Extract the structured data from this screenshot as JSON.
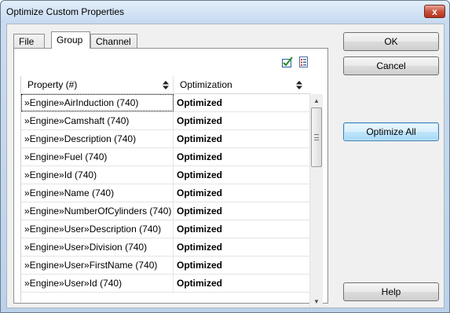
{
  "window": {
    "title": "Optimize Custom Properties",
    "close_glyph": "x"
  },
  "tabs": [
    {
      "label": "File",
      "active": false
    },
    {
      "label": "Group",
      "active": true
    },
    {
      "label": "Channel",
      "active": false
    }
  ],
  "toolbar": {
    "icons": [
      "check-all-icon",
      "properties-list-icon"
    ]
  },
  "grid": {
    "columns": [
      "Property (#)",
      "Optimization"
    ],
    "rows": [
      {
        "property": "»Engine»AirInduction (740)",
        "optimization": "Optimized"
      },
      {
        "property": "»Engine»Camshaft (740)",
        "optimization": "Optimized"
      },
      {
        "property": "»Engine»Description (740)",
        "optimization": "Optimized"
      },
      {
        "property": "»Engine»Fuel (740)",
        "optimization": "Optimized"
      },
      {
        "property": "»Engine»Id (740)",
        "optimization": "Optimized"
      },
      {
        "property": "»Engine»Name (740)",
        "optimization": "Optimized"
      },
      {
        "property": "»Engine»NumberOfCylinders (740)",
        "optimization": "Optimized"
      },
      {
        "property": "»Engine»User»Description (740)",
        "optimization": "Optimized"
      },
      {
        "property": "»Engine»User»Division (740)",
        "optimization": "Optimized"
      },
      {
        "property": "»Engine»User»FirstName (740)",
        "optimization": "Optimized"
      },
      {
        "property": "»Engine»User»Id (740)",
        "optimization": "Optimized"
      }
    ]
  },
  "buttons": {
    "ok": "OK",
    "cancel": "Cancel",
    "optimize_all": "Optimize All",
    "help": "Help"
  },
  "colors": {
    "accent": "#3c7fb1",
    "titlebar": "#c6daf0",
    "close": "#c9523c"
  }
}
